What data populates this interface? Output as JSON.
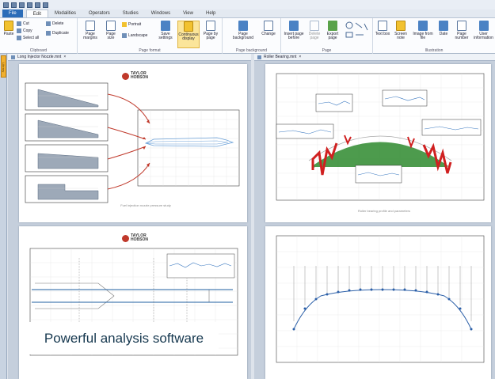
{
  "ribbon": {
    "tabs": [
      "File",
      "Edit",
      "Modalities",
      "Operators",
      "Studies",
      "Windows",
      "View",
      "Help"
    ],
    "active_tab": "Edit",
    "clipboard": {
      "paste": "Paste",
      "cut": "Cut",
      "copy": "Copy",
      "select_all": "Select all",
      "delete": "Delete",
      "duplicate": "Duplicate",
      "label": "Clipboard"
    },
    "page_format": {
      "portrait": "Portrait",
      "landscape": "Landscape",
      "page_margins": "Page margins",
      "page_size": "Page size",
      "save_settings": "Save settings",
      "continuous": "Continuous display",
      "page_by_page": "Page by page",
      "label": "Page format"
    },
    "page_background": {
      "page_background": "Page background",
      "change": "Change",
      "label": "Page background"
    },
    "page": {
      "insert_before": "Insert page before",
      "delete_page": "Delete page",
      "export_page": "Export page",
      "label": "Page"
    },
    "illustration": {
      "text_box": "Text box",
      "screen_note": "Screen note",
      "image_from_file": "Image from file",
      "date": "Date",
      "page_number": "Page number",
      "user_information": "User information",
      "label": "Illustration"
    }
  },
  "sidebar": {
    "tab": "Library"
  },
  "panels": [
    {
      "title": "Long Injector Nozzle.mnt",
      "caption": "Fuel injection nozzle pressure study"
    },
    {
      "title": "Roller Bearing.mnt",
      "caption": "Roller bearing profile and parameters"
    }
  ],
  "logo": {
    "line1": "TAYLOR",
    "line2": "HOBSON"
  },
  "banner": "Powerful analysis software"
}
